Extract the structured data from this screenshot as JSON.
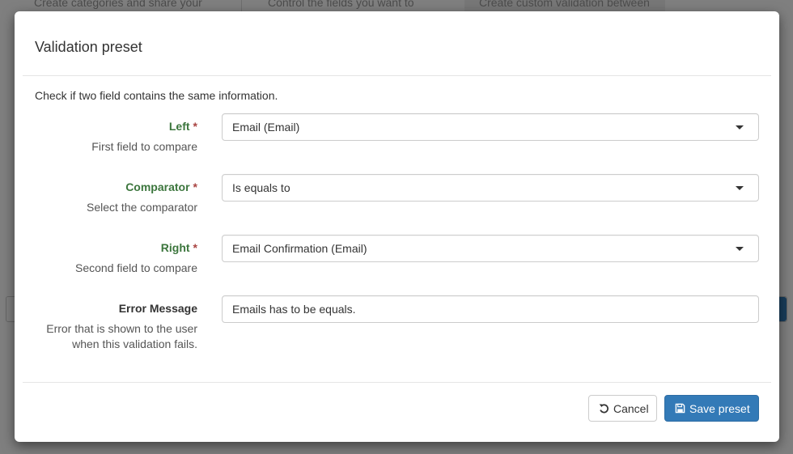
{
  "background": {
    "cards": [
      "Create categories and share your",
      "Control the fields you want to",
      "Create custom validation between"
    ]
  },
  "modal": {
    "title": "Validation preset",
    "intro": "Check if two field contains the same information.",
    "fields": [
      {
        "label": "Left",
        "required": true,
        "required_mark": "*",
        "help": "First field to compare",
        "type": "select",
        "value": "Email (Email)"
      },
      {
        "label": "Comparator",
        "required": true,
        "required_mark": "*",
        "help": "Select the comparator",
        "type": "select",
        "value": "Is equals to"
      },
      {
        "label": "Right",
        "required": true,
        "required_mark": "*",
        "help": "Second field to compare",
        "type": "select",
        "value": "Email Confirmation (Email)"
      },
      {
        "label": "Error Message",
        "required": false,
        "help_line1": "Error that is shown to the user",
        "help_line2": "when this validation fails.",
        "type": "text",
        "value": "Emails has to be equals."
      }
    ],
    "footer": {
      "cancel_label": "Cancel",
      "cancel_icon": "undo-icon",
      "save_label": "Save preset",
      "save_icon": "floppy-disk-icon"
    }
  },
  "colors": {
    "label_success": "#3c763d",
    "required_mark": "#a94442",
    "primary": "#337ab7"
  }
}
